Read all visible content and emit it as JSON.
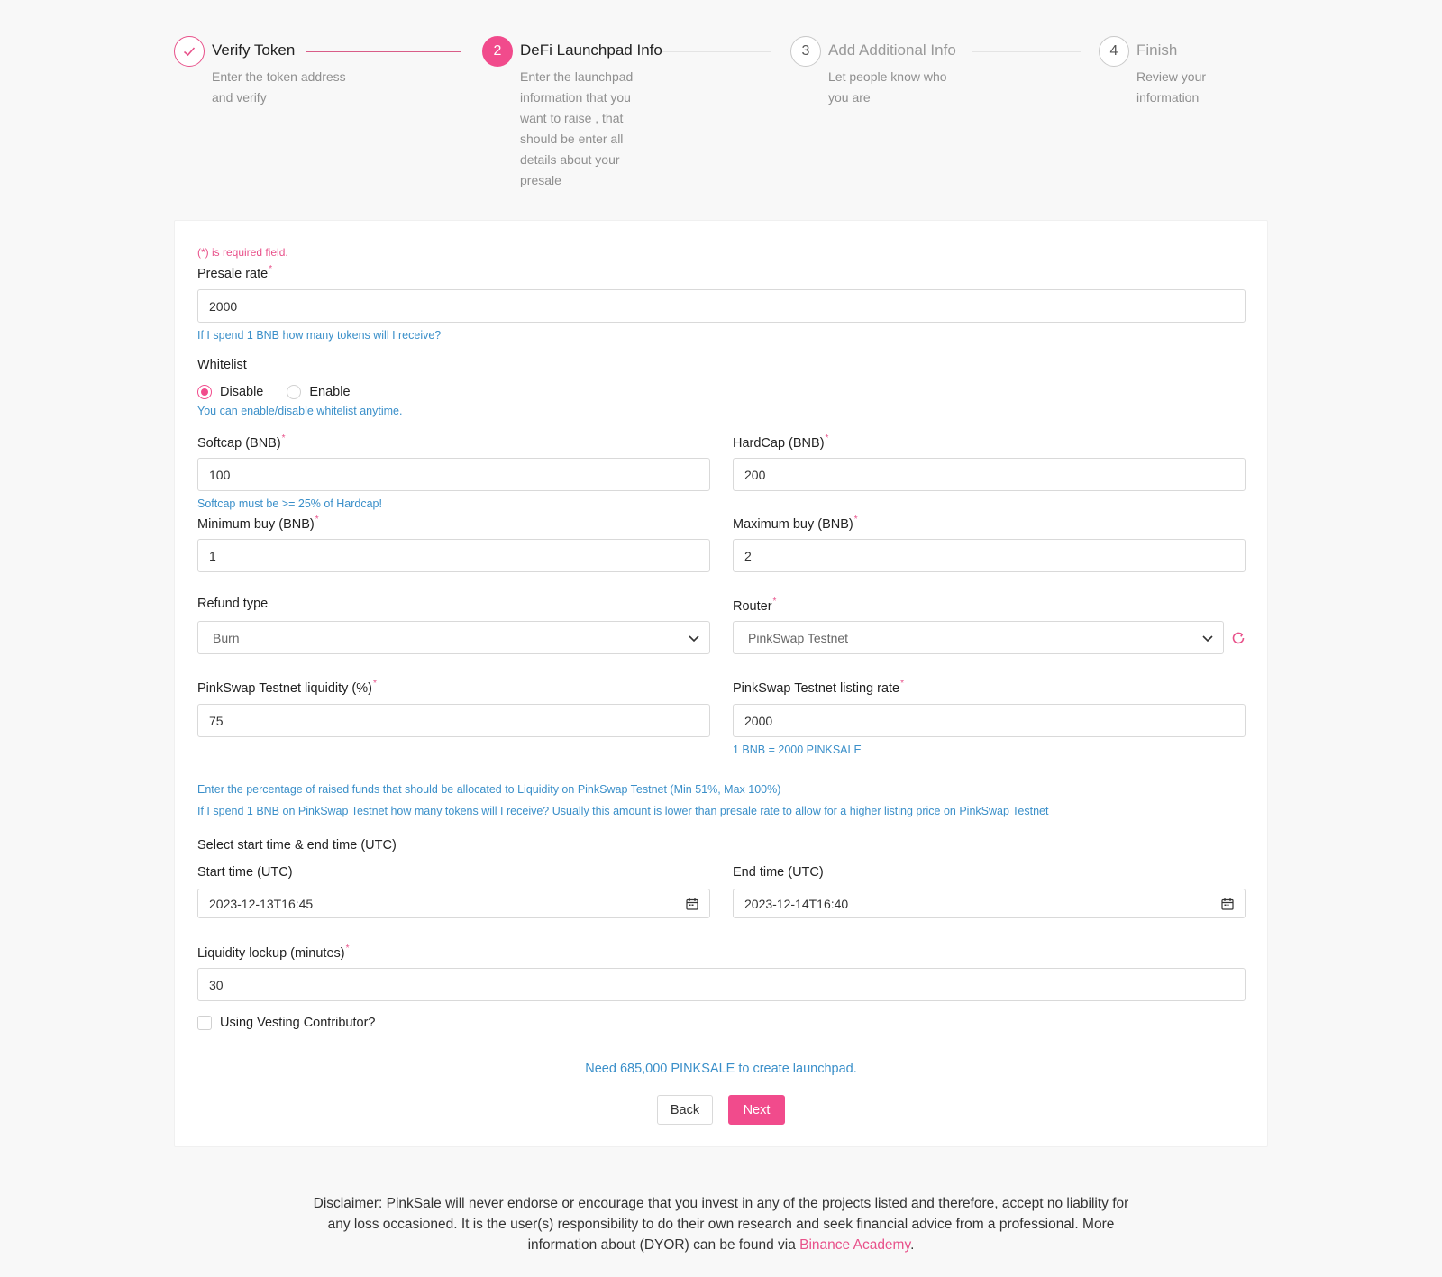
{
  "steps": [
    {
      "number": "",
      "title": "Verify Token",
      "desc": "Enter the token address and verify",
      "state": "done"
    },
    {
      "number": "2",
      "title": "DeFi Launchpad Info",
      "desc": "Enter the launchpad information that you want to raise , that should be enter all details about your presale",
      "state": "active"
    },
    {
      "number": "3",
      "title": "Add Additional Info",
      "desc": "Let people know who you are",
      "state": "pending"
    },
    {
      "number": "4",
      "title": "Finish",
      "desc": "Review your information",
      "state": "pending"
    }
  ],
  "form": {
    "required_note": "(*) is required field.",
    "presale_rate": {
      "label": "Presale rate",
      "value": "2000",
      "hint": "If I spend 1 BNB how many tokens will I receive?"
    },
    "whitelist": {
      "label": "Whitelist",
      "options": [
        "Disable",
        "Enable"
      ],
      "selected": "Disable",
      "hint": "You can enable/disable whitelist anytime."
    },
    "softcap": {
      "label": "Softcap (BNB)",
      "value": "100",
      "hint": "Softcap must be >= 25% of Hardcap!"
    },
    "hardcap": {
      "label": "HardCap (BNB)",
      "value": "200"
    },
    "min_buy": {
      "label": "Minimum buy (BNB)",
      "value": "1"
    },
    "max_buy": {
      "label": "Maximum buy (BNB)",
      "value": "2"
    },
    "refund_type": {
      "label": "Refund type",
      "value": "Burn"
    },
    "router": {
      "label": "Router",
      "value": "PinkSwap Testnet"
    },
    "liquidity_pct": {
      "label": "PinkSwap Testnet liquidity (%)",
      "value": "75"
    },
    "listing_rate": {
      "label": "PinkSwap Testnet listing rate",
      "value": "2000",
      "hint": "1 BNB = 2000 PINKSALE"
    },
    "liquidity_hint": "Enter the percentage of raised funds that should be allocated to Liquidity on PinkSwap Testnet (Min 51%, Max 100%)",
    "listing_hint": "If I spend 1 BNB on PinkSwap Testnet how many tokens will I receive? Usually this amount is lower than presale rate to allow for a higher listing price on PinkSwap Testnet",
    "time_section_label": "Select start time & end time (UTC)",
    "start_time": {
      "label": "Start time (UTC)",
      "value": "2023-12-13T16:45"
    },
    "end_time": {
      "label": "End time (UTC)",
      "value": "2023-12-14T16:40"
    },
    "lockup": {
      "label": "Liquidity lockup (minutes)",
      "value": "30"
    },
    "vesting_label": "Using Vesting Contributor?",
    "need_text": "Need 685,000 PINKSALE to create launchpad.",
    "back_label": "Back",
    "next_label": "Next"
  },
  "disclaimer": {
    "text": "Disclaimer: PinkSale will never endorse or encourage that you invest in any of the projects listed and therefore, accept no liability for any loss occasioned. It is the user(s) responsibility to do their own research and seek financial advice from a professional. More information about (DYOR) can be found via ",
    "link": "Binance Academy",
    "end": "."
  },
  "colors": {
    "accent": "#f14b8c",
    "hint": "#3a8fc9"
  }
}
